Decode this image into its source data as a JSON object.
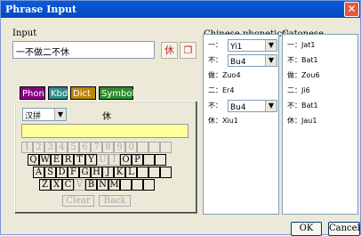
{
  "window": {
    "title": "Phrase Input",
    "close_glyph": "✕"
  },
  "input": {
    "label": "Input",
    "value": "一不做二不休",
    "btn1": "休",
    "btn2": "❐"
  },
  "tabs": [
    {
      "label": "Phon",
      "color": "#8b008b"
    },
    {
      "label": "Kbd",
      "color": "#2e8b8b"
    },
    {
      "label": "Dict",
      "color": "#b8860b"
    },
    {
      "label": "Symbol",
      "color": "#2e8b2e"
    }
  ],
  "keyboard": {
    "method": "汉拼",
    "char": "休",
    "digits": [
      "1",
      "2",
      "3",
      "4",
      "5",
      "6",
      "7",
      "8",
      "9",
      "0"
    ],
    "row_q": [
      "Q",
      "W",
      "E",
      "R",
      "T",
      "Y",
      "U",
      "I",
      "O",
      "P"
    ],
    "row_a": [
      "A",
      "S",
      "D",
      "F",
      "G",
      "H",
      "J",
      "K",
      "L"
    ],
    "row_z": [
      "Z",
      "X",
      "C",
      "V",
      "B",
      "N",
      "M"
    ],
    "clear": "Clear",
    "back": "Back"
  },
  "chinese": {
    "label": "Chinese phonetics:",
    "rows": [
      {
        "ch": "一：",
        "val": "Yi1",
        "dropdown": true
      },
      {
        "ch": "不：",
        "val": "Bu4",
        "dropdown": true
      },
      {
        "ch": "做：",
        "val": "Zuo4",
        "dropdown": false
      },
      {
        "ch": "二：",
        "val": "Er4",
        "dropdown": false
      },
      {
        "ch": "不：",
        "val": "Bu4",
        "dropdown": true
      },
      {
        "ch": "休：",
        "val": "Xiu1",
        "dropdown": false
      }
    ]
  },
  "cantonese": {
    "label": "Catonese phonetics:",
    "rows": [
      {
        "ch": "一：",
        "val": "Jat1"
      },
      {
        "ch": "不：",
        "val": "Bat1"
      },
      {
        "ch": "做：",
        "val": "Zou6"
      },
      {
        "ch": "二：",
        "val": "Ji6"
      },
      {
        "ch": "不：",
        "val": "Bat1"
      },
      {
        "ch": "休：",
        "val": "Jau1"
      }
    ]
  },
  "buttons": {
    "ok": "OK",
    "cancel": "Cancel"
  }
}
